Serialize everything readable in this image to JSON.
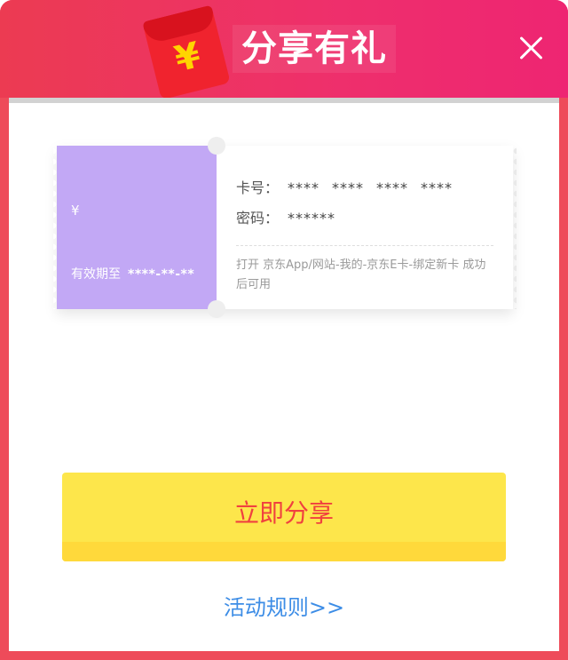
{
  "header": {
    "title": "分享有礼",
    "redpacket_symbol": "¥",
    "close_icon": "close-icon"
  },
  "card": {
    "currency_symbol": "¥",
    "expiry_label": "有效期至",
    "expiry_value": "****-**-**",
    "number_label": "卡号：",
    "number_groups": [
      "****",
      "****",
      "****",
      "****"
    ],
    "password_label": "密码：",
    "password_value": "******",
    "note": "打开 京东App/网站-我的-京东E卡-绑定新卡 成功后可用",
    "colors": {
      "stub": "#c2a8f5"
    }
  },
  "share_button": {
    "label": "立即分享",
    "color": "#fde64b"
  },
  "rules_link": {
    "label": "活动规则>>"
  },
  "colors": {
    "modal": "#ee4b5a",
    "header": "#ee2f6c",
    "link": "#3d8de6"
  }
}
